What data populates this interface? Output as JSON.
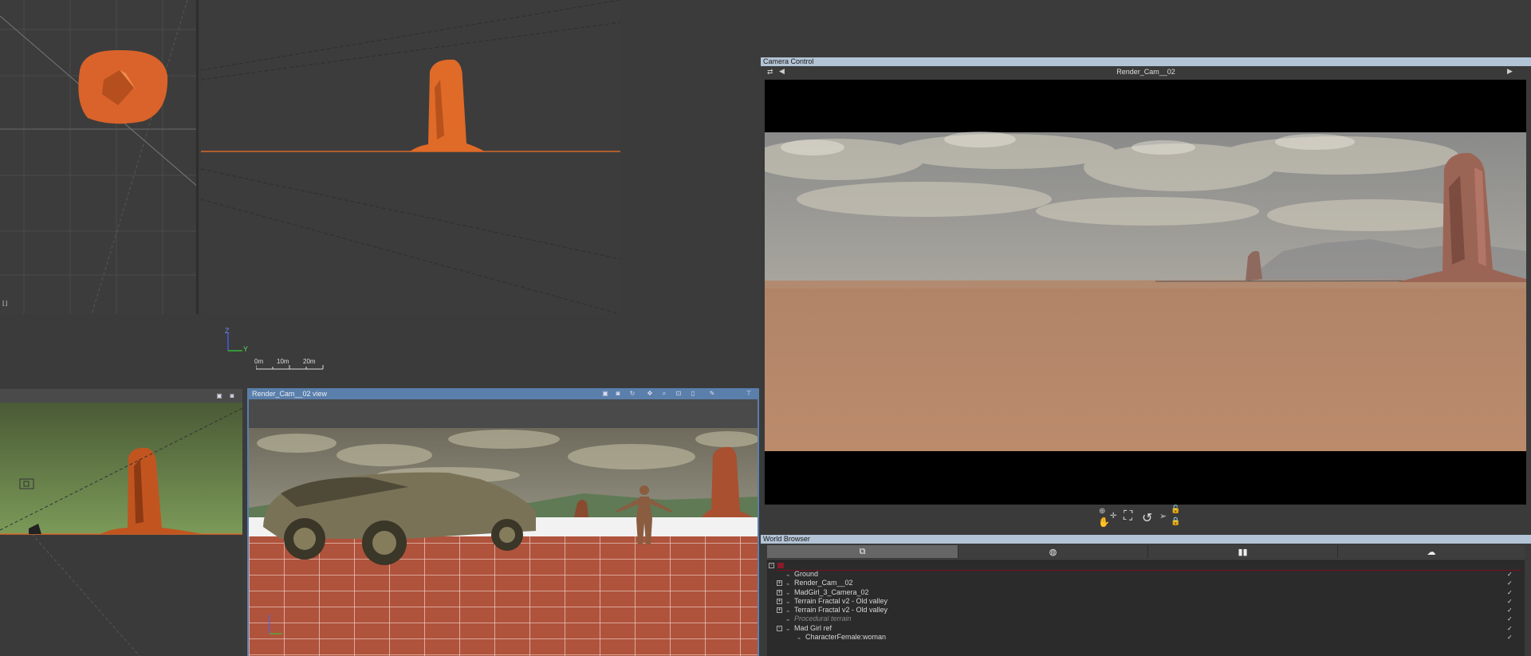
{
  "camera_control": {
    "title": "Camera Control",
    "camera_name": "Render_Cam__02"
  },
  "render_view": {
    "title": "Render_Cam__02 view"
  },
  "axes_view": {
    "axis_z": "Z",
    "axis_y": "Y",
    "scale_labels": [
      "0m",
      "10m",
      "20m"
    ]
  },
  "world_browser": {
    "title": "World Browser",
    "tabs": [
      {
        "icon": "objects-icon"
      },
      {
        "icon": "materials-icon"
      },
      {
        "icon": "statistics-icon"
      },
      {
        "icon": "atmosphere-icon"
      }
    ],
    "items": [
      {
        "label": "Ground",
        "indent": 1,
        "expander": "",
        "style": "normal"
      },
      {
        "label": "Render_Cam__02",
        "indent": 1,
        "expander": "+",
        "style": "normal"
      },
      {
        "label": "MadGirl_3_Camera_02",
        "indent": 1,
        "expander": "+",
        "style": "normal"
      },
      {
        "label": "Terrain Fractal v2 - Old valley",
        "indent": 1,
        "expander": "+",
        "style": "normal"
      },
      {
        "label": "Terrain Fractal v2 - Old valley",
        "indent": 1,
        "expander": "+",
        "style": "normal"
      },
      {
        "label": "Procedural terrain",
        "indent": 1,
        "expander": "",
        "style": "italic"
      },
      {
        "label": "Mad Girl ref",
        "indent": 1,
        "expander": "-",
        "style": "normal"
      },
      {
        "label": "CharacterFemale:woman",
        "indent": 2,
        "expander": "",
        "style": "normal"
      }
    ]
  },
  "colors": {
    "viewport_bg": "#3c3c3c",
    "rock_orange": "#e06a28",
    "title_bar_blue": "#5a7fab",
    "panel_header": "#b3c4d6",
    "sand": "#b88a6c"
  }
}
